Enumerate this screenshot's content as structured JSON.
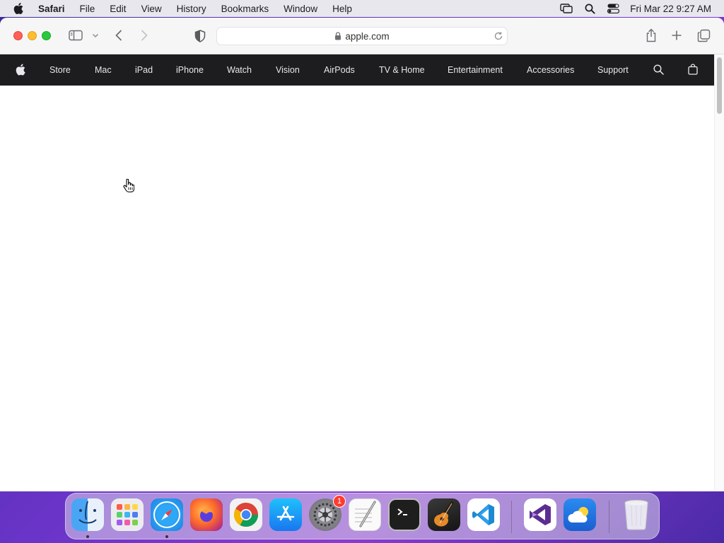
{
  "menubar": {
    "app_name": "Safari",
    "items": [
      "File",
      "Edit",
      "View",
      "History",
      "Bookmarks",
      "Window",
      "Help"
    ],
    "clock": "Fri Mar 22  9:27 AM",
    "tray_icons": [
      "screen-mirroring-icon",
      "spotlight-search-icon",
      "control-center-icon"
    ]
  },
  "browser": {
    "url": "apple.com",
    "toolbar_icons": [
      "sidebar-icon",
      "chevron-down-icon",
      "back-icon",
      "forward-icon",
      "privacy-shield-icon",
      "share-icon",
      "new-tab-icon",
      "tab-overview-icon"
    ]
  },
  "site_nav": {
    "items": [
      "Store",
      "Mac",
      "iPad",
      "iPhone",
      "Watch",
      "Vision",
      "AirPods",
      "TV & Home",
      "Entertainment",
      "Accessories",
      "Support"
    ]
  },
  "dock": {
    "apps": [
      "Finder",
      "Launchpad",
      "Safari",
      "Firefox",
      "Chrome",
      "App Store",
      "System Settings",
      "TextEdit",
      "Terminal",
      "GarageBand",
      "Visual Studio Code",
      "Visual Studio",
      "Weather",
      "Trash"
    ],
    "settings_badge": "1"
  }
}
